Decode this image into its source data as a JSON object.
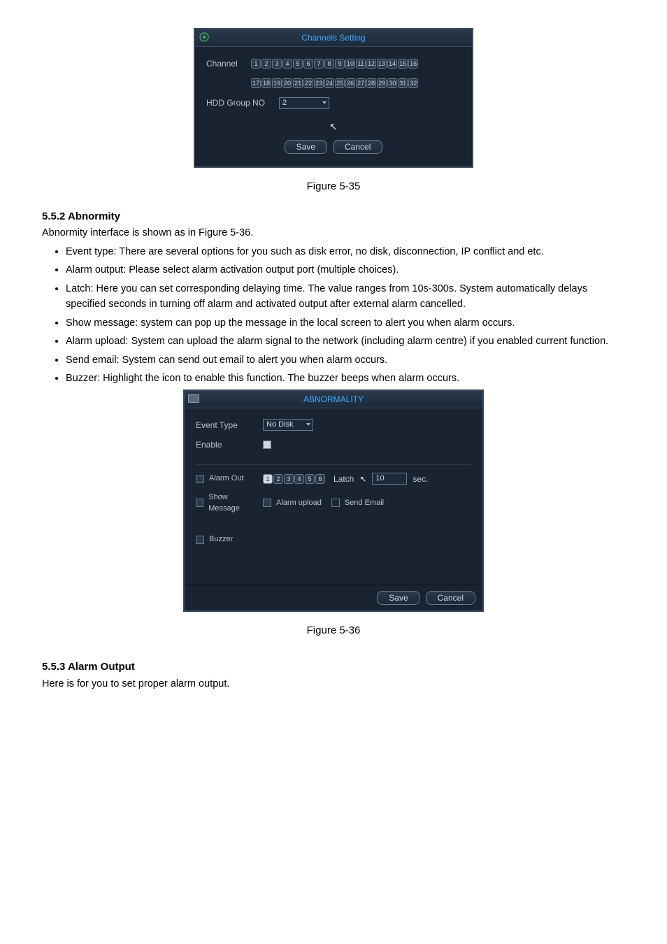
{
  "dialog1": {
    "title": "Channels Setting",
    "channel_label": "Channel",
    "channels_row1": [
      "1",
      "2",
      "3",
      "4",
      "5",
      "6",
      "7",
      "8",
      "9",
      "10",
      "11",
      "12",
      "13",
      "14",
      "15",
      "16"
    ],
    "channels_row2": [
      "17",
      "18",
      "19",
      "20",
      "21",
      "22",
      "23",
      "24",
      "25",
      "26",
      "27",
      "28",
      "29",
      "30",
      "31",
      "32"
    ],
    "hdd_label": "HDD Group NO",
    "hdd_value": "2",
    "save_label": "Save",
    "cancel_label": "Cancel"
  },
  "fig1_caption": "Figure 5-35",
  "sec552": {
    "heading": "5.5.2  Abnormity",
    "intro": "Abnormity interface is shown as in Figure 5-36.",
    "bullets": [
      "Event type: There are several options for you such as disk error, no disk, disconnection, IP conflict and etc.",
      "Alarm output: Please select alarm activation output port (multiple choices).",
      "Latch: Here you can set corresponding delaying time. The value ranges from 10s-300s. System automatically delays specified seconds in turning off alarm and activated output after external alarm cancelled.",
      "Show message: system can pop up the message in the local screen to alert you when alarm occurs.",
      "Alarm upload: System can upload the alarm signal to the network (including alarm centre) if you enabled current function.",
      "Send email: System can send out email to alert you when alarm occurs.",
      "Buzzer: Highlight the icon to enable this function. The buzzer beeps when alarm occurs."
    ]
  },
  "dialog2": {
    "title": "ABNORMALITY",
    "event_type_label": "Event Type",
    "event_type_value": "No Disk",
    "enable_label": "Enable",
    "alarm_out_label": "Alarm Out",
    "alarm_out_chips": [
      "1",
      "2",
      "3",
      "4",
      "5",
      "6"
    ],
    "latch_label": "Latch",
    "latch_value": "10",
    "latch_unit": "sec.",
    "show_message_label": "Show Message",
    "alarm_upload_label": "Alarm upload",
    "send_email_label": "Send Email",
    "buzzer_label": "Buzzer",
    "save_label": "Save",
    "cancel_label": "Cancel"
  },
  "fig2_caption": "Figure 5-36",
  "sec553": {
    "heading": "5.5.3  Alarm Output",
    "intro": "Here is for you to set proper alarm output."
  }
}
